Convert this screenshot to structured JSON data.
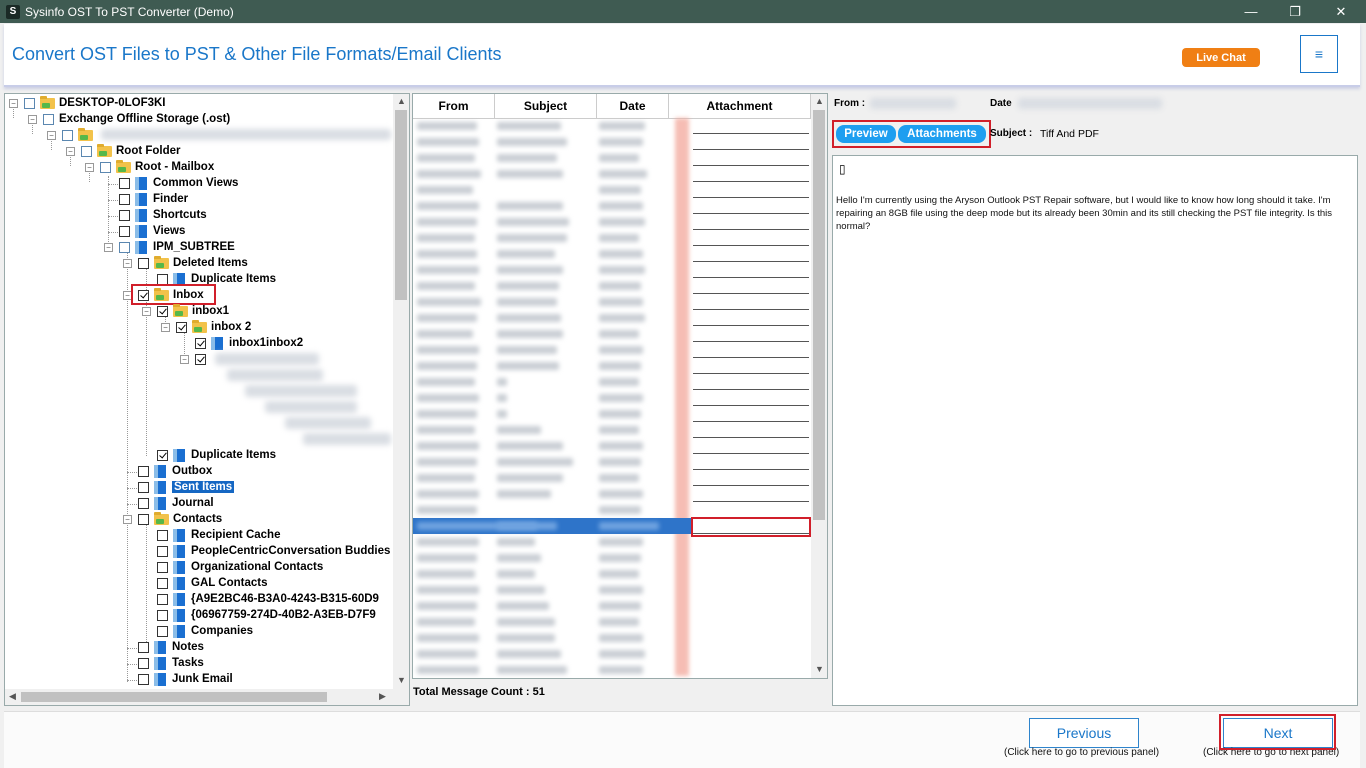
{
  "window": {
    "title": "Sysinfo OST To PST Converter (Demo)",
    "icon_letter": "S",
    "controls": {
      "minimize": "—",
      "maximize": "❐",
      "close": "✕"
    }
  },
  "header": {
    "heading": "Convert OST Files to PST & Other File Formats/Email Clients",
    "live_chat": "Live Chat",
    "menu_icon": "≡"
  },
  "tree": {
    "items": [
      {
        "label": "DESKTOP-0LOF3KI"
      },
      {
        "label": "Exchange Offline Storage (.ost)"
      },
      {
        "label": "Root Folder"
      },
      {
        "label": "Root - Mailbox"
      },
      {
        "label": "Common Views"
      },
      {
        "label": "Finder"
      },
      {
        "label": "Shortcuts"
      },
      {
        "label": "Views"
      },
      {
        "label": "IPM_SUBTREE"
      },
      {
        "label": "Deleted Items"
      },
      {
        "label": "Duplicate Items"
      },
      {
        "label": "Inbox"
      },
      {
        "label": "inbox1"
      },
      {
        "label": "inbox 2"
      },
      {
        "label": "inbox1inbox2"
      },
      {
        "label": "Duplicate Items"
      },
      {
        "label": "Outbox"
      },
      {
        "label": "Sent Items"
      },
      {
        "label": "Journal"
      },
      {
        "label": "Contacts"
      },
      {
        "label": "Recipient Cache"
      },
      {
        "label": "PeopleCentricConversation Buddies"
      },
      {
        "label": "Organizational Contacts"
      },
      {
        "label": "GAL Contacts"
      },
      {
        "label": "{A9E2BC46-B3A0-4243-B315-60D9"
      },
      {
        "label": "{06967759-274D-40B2-A3EB-D7F9"
      },
      {
        "label": "Companies"
      },
      {
        "label": "Notes"
      },
      {
        "label": "Tasks"
      },
      {
        "label": "Junk Email"
      }
    ]
  },
  "messages": {
    "columns": [
      "From",
      "Subject",
      "Date",
      "Attachment"
    ],
    "total_label": "Total Message Count : 51"
  },
  "preview": {
    "from_label": "From :",
    "date_label": "Date",
    "preview_tab": "Preview",
    "attachments_tab": "Attachments",
    "subject_label": "Subject :",
    "subject_value": "Tiff And PDF",
    "glyph": "▯",
    "body": "Hello I'm currently using the Aryson Outlook PST Repair software, but I would like to know how long should it take. I'm repairing an 8GB file using the deep mode but its already been 30min and its still checking the PST file integrity. Is this normal?"
  },
  "footer": {
    "previous": "Previous",
    "previous_hint": "(Click here to go to previous panel)",
    "next": "Next",
    "next_hint": "(Click here to go to next panel)"
  },
  "colors": {
    "titlebar": "#3f5b52",
    "accent": "#1a77c9",
    "live_chat": "#f07f14",
    "highlight_box": "#d11f2a",
    "selected": "#1567c3",
    "tab_button": "#1e9ef0"
  }
}
